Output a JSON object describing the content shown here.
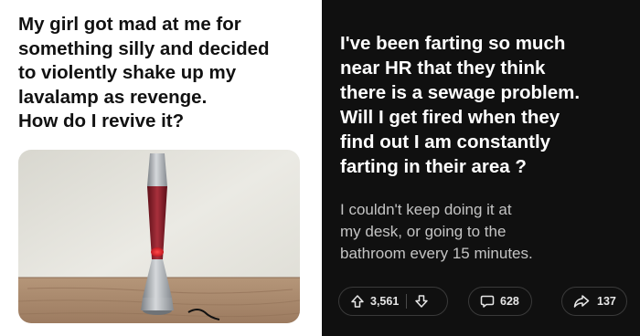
{
  "left_post": {
    "title": "My girl got mad at me for\nsomething silly and decided\nto violently shake up my\nlavalamp as revenge.\nHow do I revive it?",
    "image": {
      "subject": "lava-lamp",
      "colors": {
        "wall": "#e4e3dc",
        "table": "#b08f72",
        "base": "#9ea2a6",
        "globe": "#8a1e2a",
        "glow": "#ff3a3a"
      }
    }
  },
  "right_post": {
    "title": "I've been farting so much\nnear HR that they think\nthere is a sewage problem.\nWill I get fired when they\nfind out I am constantly\nfarting in their area ?",
    "body": "I couldn't keep doing it at\nmy desk, or going to the\nbathroom every 15 minutes.",
    "actions": {
      "upvote_icon": "arrow-up-icon",
      "downvote_icon": "arrow-down-icon",
      "votes": "3,561",
      "comments_icon": "speech-bubble-icon",
      "comments": "628",
      "share_icon": "share-arrow-icon",
      "shares": "137"
    },
    "colors": {
      "background": "#101010",
      "text": "#ffffff",
      "muted": "#c4c4c4",
      "border": "#3a3a3a"
    }
  }
}
